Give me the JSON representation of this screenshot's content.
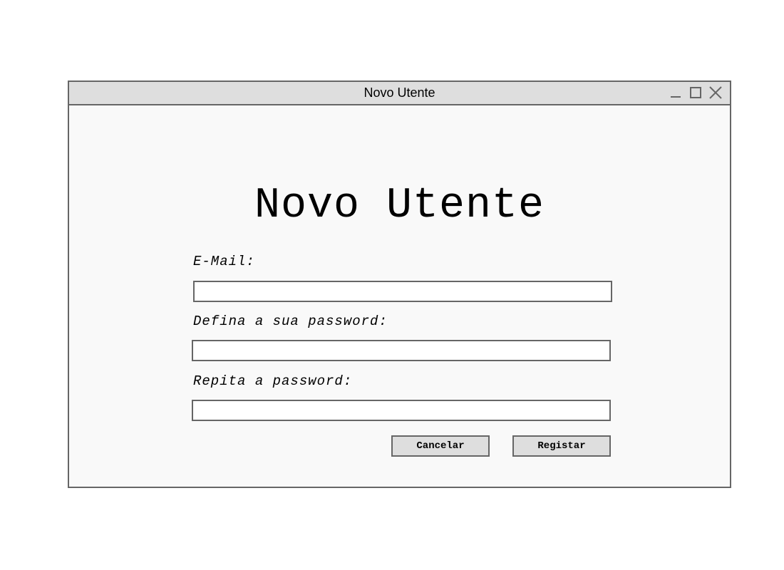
{
  "window": {
    "title": "Novo Utente"
  },
  "form": {
    "heading": "Novo Utente",
    "email_label": "E-Mail:",
    "email_value": "",
    "password_label": "Defina a sua password:",
    "password_value": "",
    "repeat_label": "Repita a password:",
    "repeat_value": "",
    "cancel_label": "Cancelar",
    "register_label": "Registar"
  },
  "icons": {
    "minimize": "minimize-icon",
    "maximize": "maximize-icon",
    "close": "close-icon"
  },
  "colors": {
    "border": "#666666",
    "titlebar_bg": "#dedede",
    "window_bg": "#f9f9f9",
    "button_bg": "#dedede"
  }
}
